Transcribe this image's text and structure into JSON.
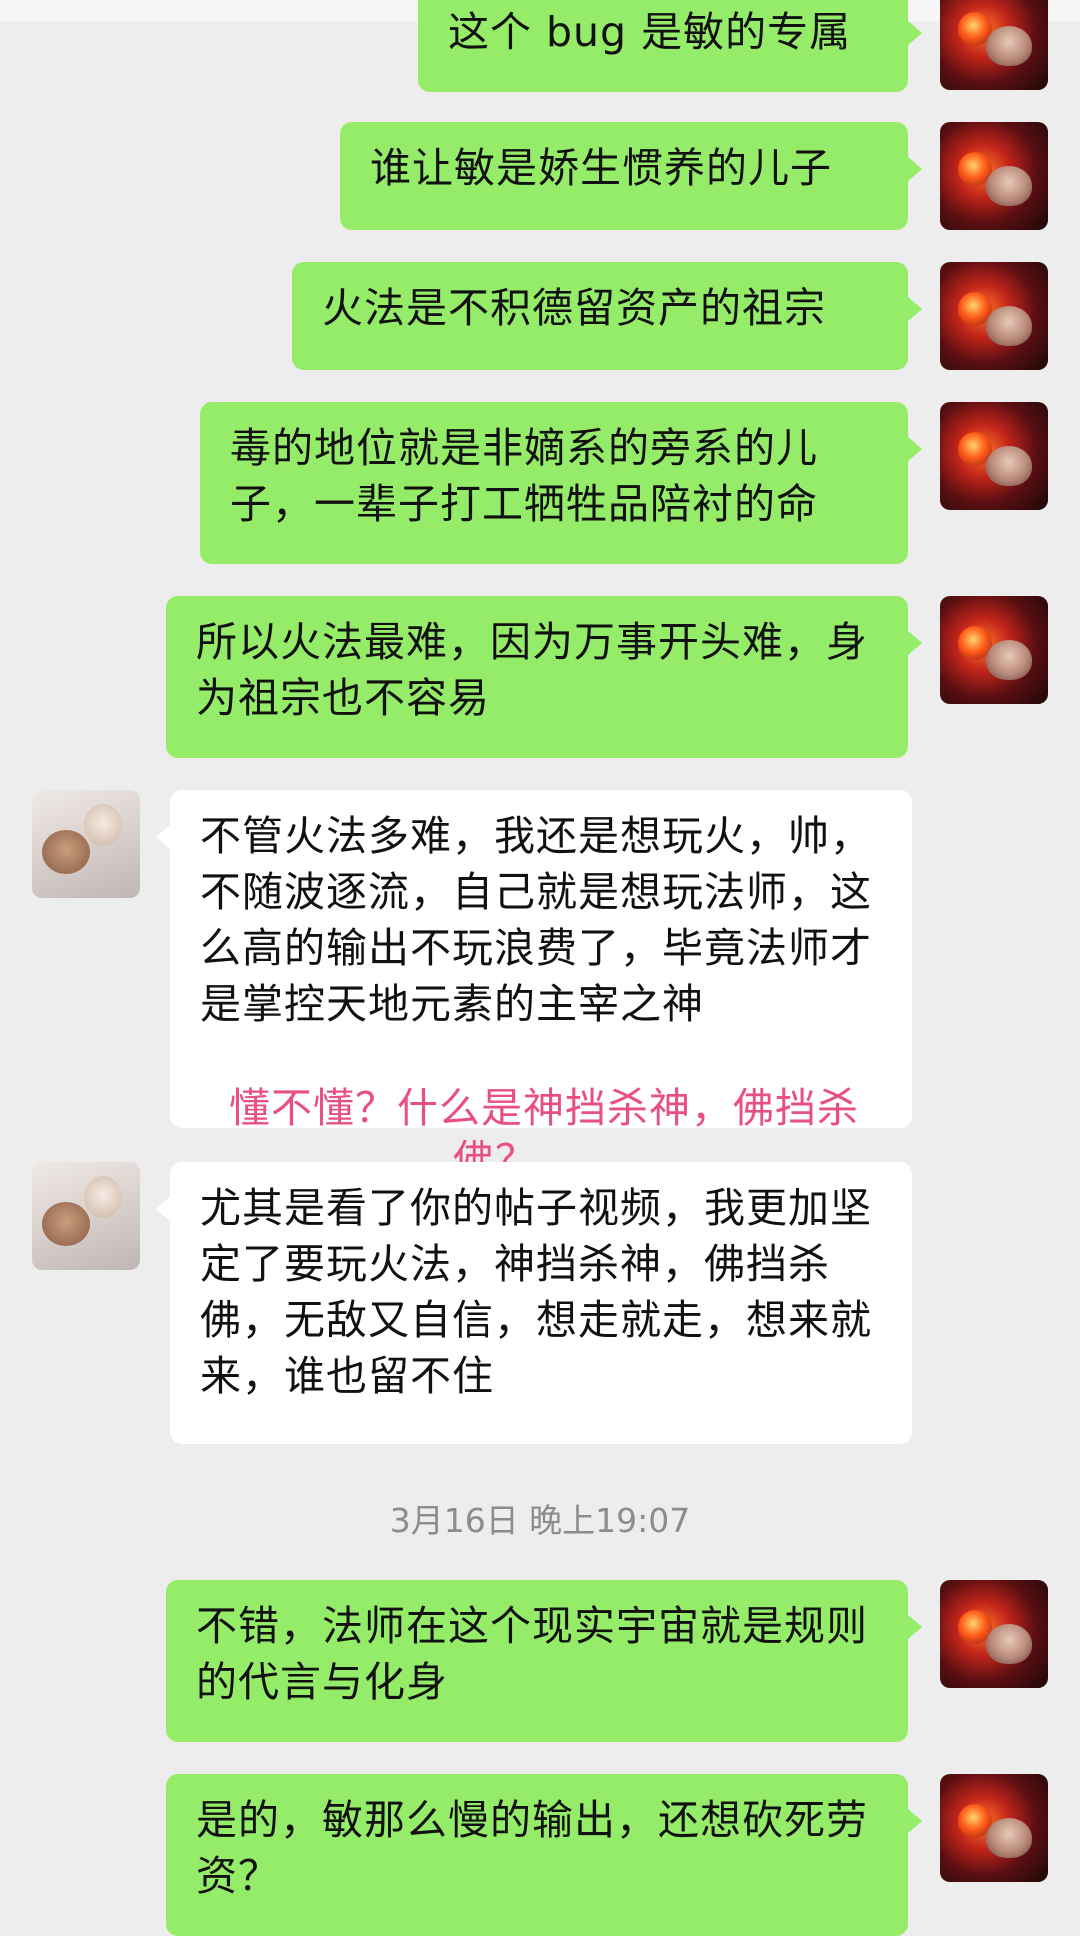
{
  "messages": [
    {
      "side": "me",
      "text": "这个 bug 是敏的专属"
    },
    {
      "side": "me",
      "text": "谁让敏是娇生惯养的儿子"
    },
    {
      "side": "me",
      "text": "火法是不积德留资产的祖宗"
    },
    {
      "side": "me",
      "text": "毒的地位就是非嫡系的旁系的儿子，一辈子打工牺牲品陪衬的命"
    },
    {
      "side": "me",
      "text": "所以火法最难，因为万事开头难，身为祖宗也不容易"
    },
    {
      "side": "them",
      "text": "不管火法多难，我还是想玩火，帅，不随波逐流，自己就是想玩法师，这么高的输出不玩浪费了，毕竟法师才是掌控天地元素的主宰之神"
    },
    {
      "side": "them",
      "text": "尤其是看了你的帖子视频，我更加坚定了要玩火法，神挡杀神，佛挡杀佛，无敌又自信，想走就走，想来就来，谁也留不住"
    },
    {
      "side": "me",
      "text": "不错，法师在这个现实宇宙就是规则的代言与化身"
    },
    {
      "side": "me",
      "text": "是的，敏那么慢的输出，还想砍死劳资？"
    }
  ],
  "timestamp": "3月16日 晚上19:07",
  "overlay_caption": "懂不懂？什么是神挡杀神，佛挡杀佛？……."
}
